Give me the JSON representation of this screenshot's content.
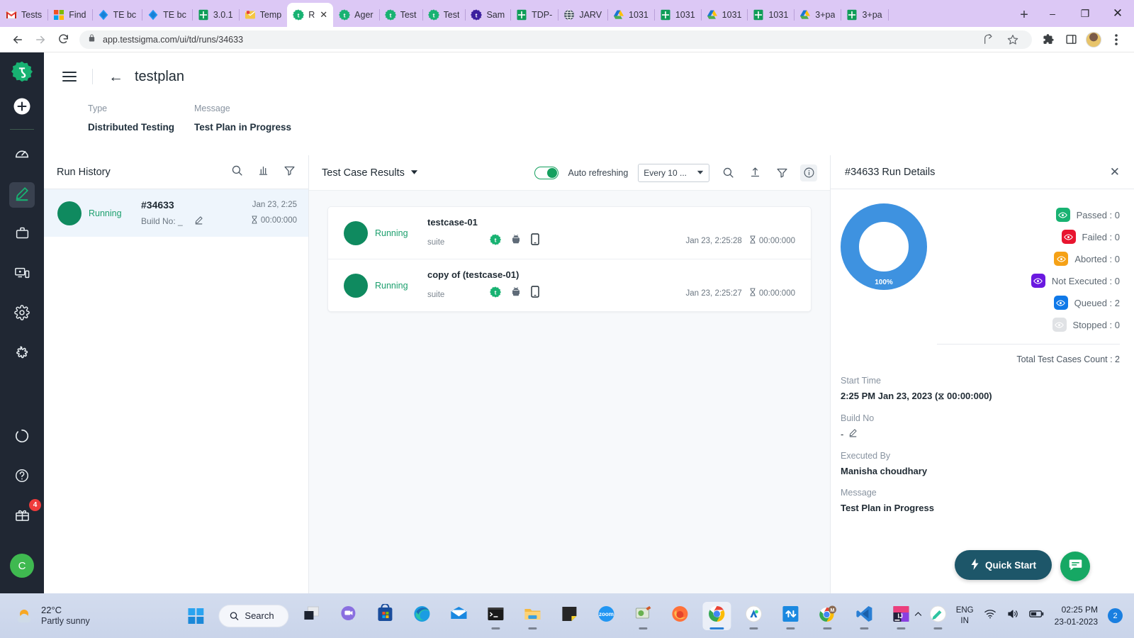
{
  "browser": {
    "tabs": [
      {
        "label": "Tests",
        "icon": "gmail-icon",
        "active": false
      },
      {
        "label": "Find ",
        "icon": "microsoft-icon",
        "active": false
      },
      {
        "label": "TE bc",
        "icon": "azure-devops-icon",
        "active": false
      },
      {
        "label": "TE bc",
        "icon": "azure-devops-icon",
        "active": false
      },
      {
        "label": "3.0.1",
        "icon": "google-sheets-icon",
        "active": false
      },
      {
        "label": "Temp",
        "icon": "mail-icon",
        "active": false
      },
      {
        "label": "R",
        "icon": "testsigma-icon",
        "active": true
      },
      {
        "label": "Ager",
        "icon": "testsigma-icon",
        "active": false
      },
      {
        "label": "Test ",
        "icon": "testsigma-icon",
        "active": false
      },
      {
        "label": "Test ",
        "icon": "testsigma-icon",
        "active": false
      },
      {
        "label": "Sam",
        "icon": "testsigma-dark-icon",
        "active": false
      },
      {
        "label": "TDP-",
        "icon": "google-sheets-icon",
        "active": false
      },
      {
        "label": "JARV",
        "icon": "globe-icon",
        "active": false
      },
      {
        "label": "1031",
        "icon": "google-drive-icon",
        "active": false
      },
      {
        "label": "1031",
        "icon": "google-sheets-icon",
        "active": false
      },
      {
        "label": "1031",
        "icon": "google-drive-icon",
        "active": false
      },
      {
        "label": "1031",
        "icon": "google-sheets-icon",
        "active": false
      },
      {
        "label": "3+pa",
        "icon": "google-drive-icon",
        "active": false
      },
      {
        "label": "3+pa",
        "icon": "google-sheets-icon",
        "active": false
      }
    ],
    "new_tab_label": "+",
    "window_minimize": "–",
    "window_maximize": "❐",
    "window_close": "✕",
    "url": "app.testsigma.com/ui/td/runs/34633",
    "tab_close_label": "✕"
  },
  "rail": {
    "logo": "testsigma-logo",
    "items": [
      {
        "name": "add-icon"
      },
      {
        "name": "dashboard-speedometer-icon"
      },
      {
        "name": "create-pencil-icon",
        "active": true
      },
      {
        "name": "briefcase-icon"
      },
      {
        "name": "devices-icon"
      },
      {
        "name": "settings-gear-icon"
      },
      {
        "name": "puzzle-plugin-icon"
      },
      {
        "name": "progress-circle-icon"
      },
      {
        "name": "help-question-icon"
      },
      {
        "name": "gift-icon"
      }
    ],
    "gift_badge": "4",
    "user_initial": "C"
  },
  "header": {
    "title": "testplan",
    "back_label": "←",
    "meta": [
      {
        "label": "Type",
        "value": "Distributed Testing"
      },
      {
        "label": "Message",
        "value": "Test Plan in Progress"
      }
    ]
  },
  "run_history": {
    "title": "Run History",
    "actions": [
      "search-icon",
      "bar-chart-icon",
      "filter-icon"
    ],
    "rows": [
      {
        "status": "Running",
        "id": "#34633",
        "build_label": "Build No: _",
        "date": "Jan 23, 2:25",
        "duration": "00:00:000",
        "edit_icon": "pencil-icon"
      }
    ]
  },
  "test_case_results": {
    "title": "Test Case Results",
    "auto_refresh_label": "Auto refreshing",
    "interval_value": "Every 10 ...",
    "actions": [
      "search-icon",
      "upload-icon",
      "filter-icon",
      "info-icon"
    ],
    "rows": [
      {
        "status": "Running",
        "name": "testcase-01",
        "suite": "suite",
        "icons": [
          "testsigma-icon",
          "android-icon",
          "mobile-device-icon"
        ],
        "date": "Jan 23, 2:25:28",
        "duration": "00:00:000"
      },
      {
        "status": "Running",
        "name": "copy of (testcase-01)",
        "suite": "suite",
        "icons": [
          "testsigma-icon",
          "android-icon",
          "mobile-device-icon"
        ],
        "date": "Jan 23, 2:25:27",
        "duration": "00:00:000"
      }
    ]
  },
  "run_details": {
    "title": "#34633 Run Details",
    "close_label": "✕",
    "donut_label": "100%",
    "legend": [
      {
        "label": "Passed : 0",
        "color": "#18b272"
      },
      {
        "label": "Failed : 0",
        "color": "#e8152f"
      },
      {
        "label": "Aborted : 0",
        "color": "#f5a116"
      },
      {
        "label": "Not Executed : 0",
        "color": "#6a19e0"
      },
      {
        "label": "Queued : 2",
        "color": "#1079e8"
      },
      {
        "label": "Stopped : 0",
        "color": "#e0e2e5"
      }
    ],
    "total": "Total Test Cases Count : 2",
    "fields": [
      {
        "label": "Start Time",
        "value": "2:25 PM Jan 23, 2023  (⧖ 00:00:000)"
      },
      {
        "label": "Build No",
        "value": "-",
        "has_edit": true
      },
      {
        "label": "Executed By",
        "value": "Manisha choudhary"
      },
      {
        "label": "Message",
        "value": "Test Plan in Progress"
      }
    ]
  },
  "chart_data": {
    "type": "pie",
    "title": "#34633 Run Details",
    "categories": [
      "Passed",
      "Failed",
      "Aborted",
      "Not Executed",
      "Queued",
      "Stopped"
    ],
    "values": [
      0,
      0,
      0,
      0,
      2,
      0
    ],
    "colors": [
      "#18b272",
      "#e8152f",
      "#f5a116",
      "#6a19e0",
      "#3e92e0",
      "#e0e2e5"
    ],
    "labels": [
      "100%"
    ],
    "total": 2,
    "legend_position": "right",
    "donut": true
  },
  "floating": {
    "quick_start": "Quick Start",
    "quick_start_icon": "lightning-icon",
    "chat_icon": "chat-bubble-icon"
  },
  "taskbar": {
    "weather_temp": "22°C",
    "weather_desc": "Partly sunny",
    "search_placeholder": "Search",
    "apps": [
      {
        "name": "task-view-icon"
      },
      {
        "name": "teams-chat-icon"
      },
      {
        "name": "microsoft-store-icon"
      },
      {
        "name": "edge-icon"
      },
      {
        "name": "mail-icon"
      },
      {
        "name": "terminal-icon",
        "running": true
      },
      {
        "name": "file-explorer-icon",
        "running": true
      },
      {
        "name": "sticky-notes-icon"
      },
      {
        "name": "zoom-icon"
      },
      {
        "name": "snipping-tool-icon",
        "running": true
      },
      {
        "name": "firefox-icon"
      },
      {
        "name": "chrome-icon",
        "running": true,
        "active": true
      },
      {
        "name": "android-studio-icon",
        "running": true
      },
      {
        "name": "upload-download-icon",
        "running": true
      },
      {
        "name": "chrome-m-icon",
        "running": true
      },
      {
        "name": "vscode-icon",
        "running": true
      },
      {
        "name": "intellij-icon",
        "running": true
      },
      {
        "name": "postman-icon",
        "running": true
      }
    ],
    "language": "ENG",
    "region": "IN",
    "time": "02:25 PM",
    "date": "23-01-2023",
    "notification_count": "2"
  }
}
